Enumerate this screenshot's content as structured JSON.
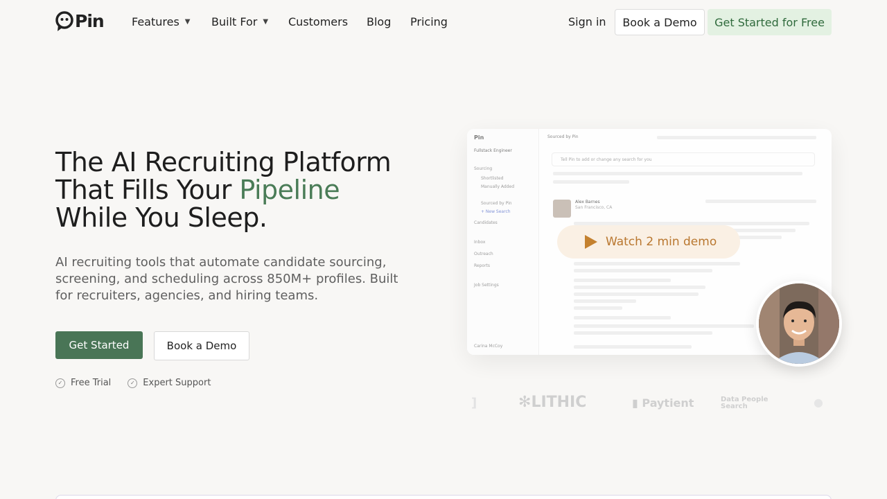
{
  "brand": {
    "name": "Pin",
    "accent": "#497556"
  },
  "nav": {
    "items": [
      {
        "label": "Features",
        "has_dropdown": true
      },
      {
        "label": "Built For",
        "has_dropdown": true
      },
      {
        "label": "Customers",
        "has_dropdown": false
      },
      {
        "label": "Blog",
        "has_dropdown": false
      },
      {
        "label": "Pricing",
        "has_dropdown": false
      }
    ],
    "sign_in": "Sign in",
    "book_demo": "Book a Demo",
    "get_started": "Get Started for Free"
  },
  "hero": {
    "title_line1": "The AI Recruiting Platform",
    "title_line2_pre": "That Fills Your ",
    "title_line2_highlight": "Pipeline",
    "title_line3": "While You Sleep.",
    "subtitle": "AI recruiting tools that automate candidate sourcing, screening, and scheduling across 850M+ profiles. Built for recruiters, agencies, and hiring teams.",
    "cta_primary": "Get Started",
    "cta_secondary": "Book a Demo",
    "perks": [
      "Free Trial",
      "Expert Support"
    ]
  },
  "preview": {
    "app_name": "Pin",
    "job": "Fullstack Engineer",
    "sidebar_items": [
      "Sourcing",
      "Shortlisted",
      "Manually Added",
      "Sourced by Pin",
      "+ New Search",
      "Candidates",
      "Inbox",
      "Outreach",
      "Reports",
      "Job Settings"
    ],
    "user": "Carina McCoy",
    "header_title": "Sourced by Pin",
    "search_placeholder": "Tell Pin to add or change any search for you",
    "candidate_name": "Alex Barnes",
    "candidate_location": "San Francisco, CA",
    "watch_label": "Watch 2 min demo"
  },
  "logos": [
    "LITHIC",
    "Paytient",
    "Data People Search"
  ]
}
